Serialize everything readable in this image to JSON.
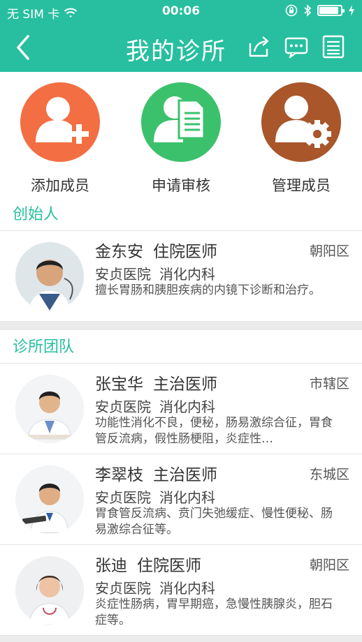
{
  "status_bar": {
    "carrier": "无 SIM 卡",
    "time": "00:06",
    "battery_level": 0.9
  },
  "nav": {
    "title": "我的诊所",
    "back_icon": "chevron-left-icon",
    "share_icon": "share-icon",
    "message_icon": "message-icon",
    "list_icon": "list-icon"
  },
  "actions": [
    {
      "label": "添加成员",
      "color": "#f36e43",
      "icon": "add-person-icon"
    },
    {
      "label": "申请审核",
      "color": "#3bc16b",
      "icon": "document-person-icon"
    },
    {
      "label": "管理成员",
      "color": "#a8562a",
      "icon": "person-gear-icon"
    }
  ],
  "founder_section": {
    "title": "创始人",
    "members": [
      {
        "name": "金东安",
        "title": "住院医师",
        "district": "朝阳区",
        "hospital": "安贞医院",
        "department": "消化内科",
        "description": "擅长胃肠和胰胆疾病的内镜下诊断和治疗。"
      }
    ]
  },
  "team_section": {
    "title": "诊所团队",
    "members": [
      {
        "name": "张宝华",
        "title": "主治医师",
        "district": "市辖区",
        "hospital": "安贞医院",
        "department": "消化内科",
        "description": "功能性消化不良，便秘，肠易激综合征，胃食管反流病，假性肠梗阻，炎症性…"
      },
      {
        "name": "李翠枝",
        "title": "主治医师",
        "district": "东城区",
        "hospital": "安贞医院",
        "department": "消化内科",
        "description": "胃食管反流病、贲门失弛缓症、慢性便秘、肠易激综合征等。"
      },
      {
        "name": "张迪",
        "title": "住院医师",
        "district": "朝阳区",
        "hospital": "安贞医院",
        "department": "消化内科",
        "description": "炎症性肠病，胃早期癌，急慢性胰腺炎，胆石症等。"
      }
    ]
  },
  "colors": {
    "accent": "#27bfa0",
    "background": "#ebebeb"
  }
}
